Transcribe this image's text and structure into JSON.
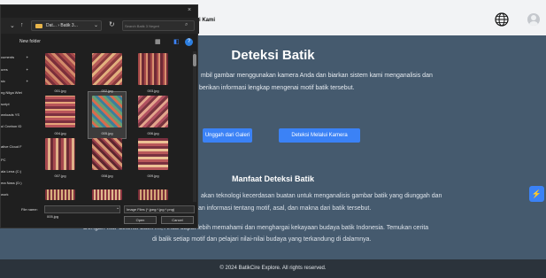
{
  "web": {
    "nav_link": "ungi Kami",
    "hero_title": "Deteksi Batik",
    "hero_line1": "mbil gambar menggunakan kamera Anda dan biarkan sistem kami menganalisis dan",
    "hero_line2": "berikan informasi lengkap mengenai motif batik tersebut.",
    "btn_gallery": "Unggah dari Galeri",
    "btn_camera": "Deteksi Melalui Kamera",
    "section_title": "Manfaat Deteksi Batik",
    "desc_line1": "akan teknologi kecerdasan buatan untuk menganalisis gambar batik yang diunggah dan",
    "desc_line2": "an informasi tentang motif, asal, dan makna dari batik tersebut.",
    "desc_line3": "Dengan fitur deteksi batik ini, Anda dapat lebih memahami dan menghargai kekayaan budaya batik Indonesia. Temukan cerita",
    "desc_line4": "di balik setiap motif dan pelajari nilai-nilai budaya yang terkandung di dalamnya.",
    "footer": "© 2024 BatikCire Explore. All rights reserved.",
    "accent": "#3b82f6"
  },
  "dialog": {
    "close": "×",
    "path": "Dat... › Batik 3...",
    "search_placeholder": "Search Batik 3 Negeri",
    "new_folder": "New folder",
    "sidebar": [
      {
        "label": "cuments",
        "pinned": true
      },
      {
        "label": "ures",
        "pinned": true
      },
      {
        "label": "sic",
        "pinned": true
      },
      {
        "label": "ng Nilga Wiet",
        "pinned": false
      },
      {
        "label": "script",
        "pinned": false
      },
      {
        "label": "wnloads YS",
        "pinned": false
      },
      {
        "label": "ul Cnebon ID",
        "pinned": false
      },
      {
        "label": "ative Cloud F",
        "pinned": false
      },
      {
        "label": "PC",
        "pinned": false
      },
      {
        "label": "ala Lena (C:)",
        "pinned": false
      },
      {
        "label": "ma Nass (D:)",
        "pinned": false
      },
      {
        "label": "work",
        "pinned": false
      }
    ],
    "files": [
      "001.jpg",
      "002.jpg",
      "003.jpg",
      "004.jpg",
      "005.jpg",
      "006.jpg",
      "007.jpg",
      "008.jpg",
      "009.jpg"
    ],
    "filename_label": "File name:",
    "filename_value": "005.jpg",
    "filetype": "Image Files (*.jpeg;*.jpg;*.png)",
    "open": "Open",
    "cancel": "Cancel"
  }
}
